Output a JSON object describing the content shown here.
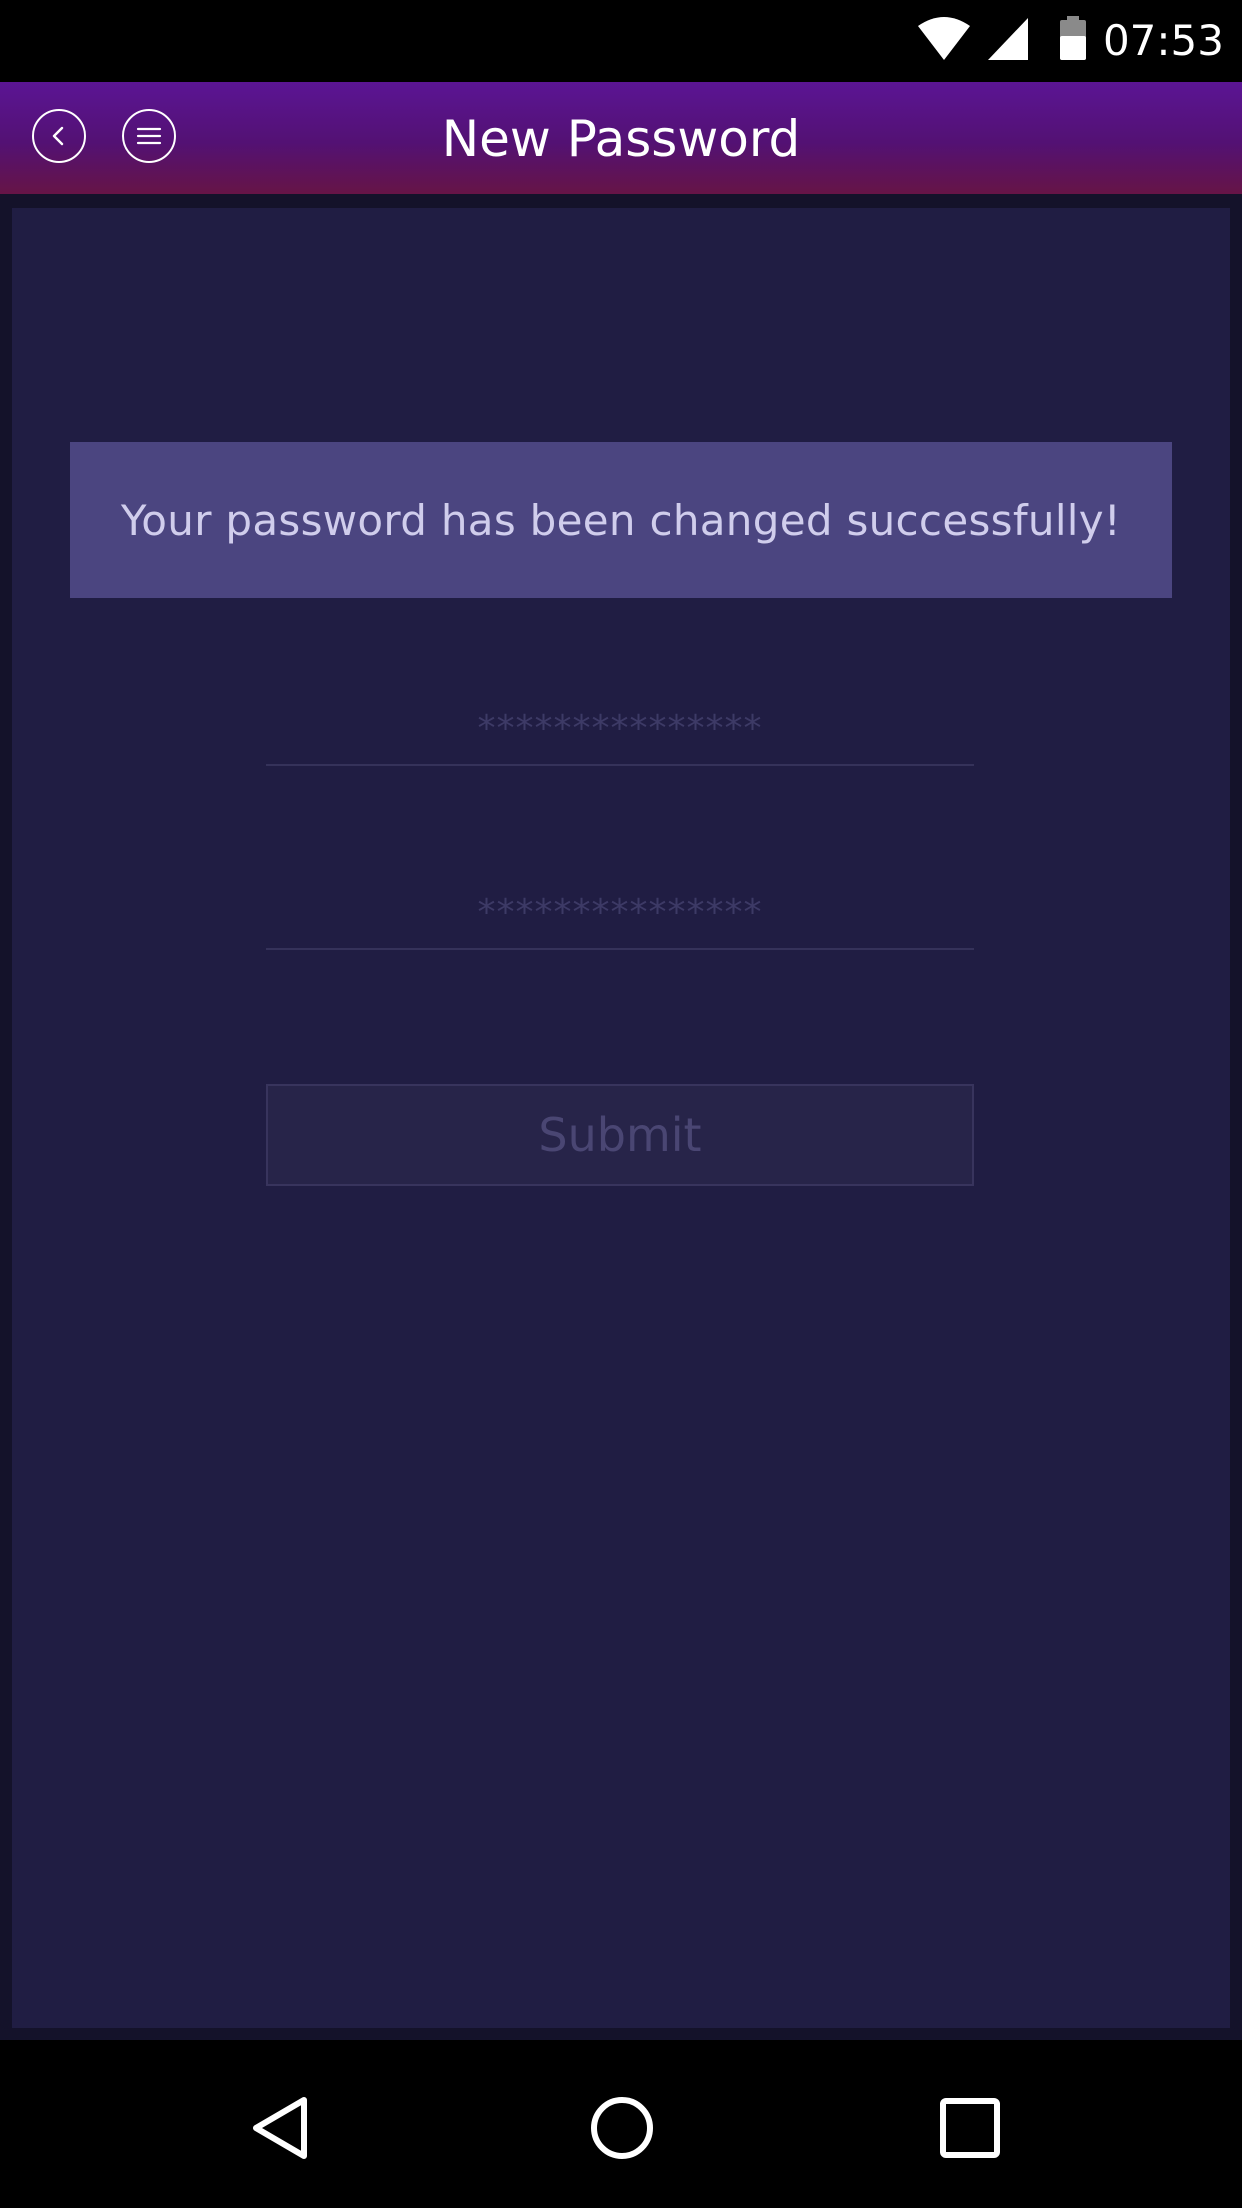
{
  "status_bar": {
    "time": "07:53",
    "icons": [
      "wifi-icon",
      "cell-signal-icon",
      "battery-icon"
    ]
  },
  "app_bar": {
    "title": "New Password",
    "back_icon": "chevron-left-icon",
    "menu_icon": "hamburger-menu-icon",
    "gradient_colors": [
      "#5b1594",
      "#661446"
    ]
  },
  "form": {
    "success_message": "Your password has been changed successfully!",
    "new_password": {
      "placeholder": "***************"
    },
    "confirm_password": {
      "placeholder": "***************"
    },
    "submit_label": "Submit"
  },
  "nav_bar": {
    "icons": [
      "back-triangle-icon",
      "home-circle-icon",
      "recents-square-icon"
    ]
  },
  "colors": {
    "background": "#201d43",
    "message_box": "#4b4580",
    "message_text": "#d0cdec",
    "disabled_text": "#4a4673"
  }
}
